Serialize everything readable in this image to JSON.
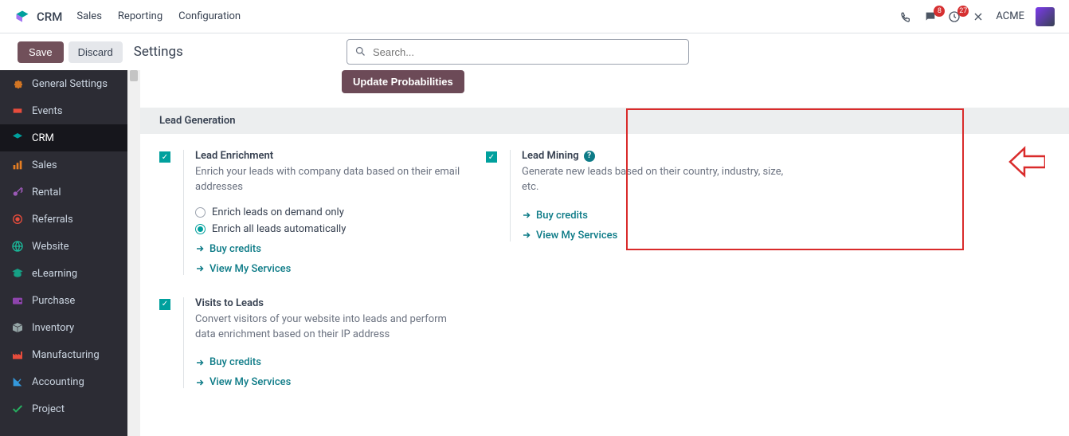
{
  "header": {
    "app_name": "CRM",
    "menu": [
      "Sales",
      "Reporting",
      "Configuration"
    ],
    "company": "ACME",
    "badge_messages": "8",
    "badge_activities": "27"
  },
  "subheader": {
    "save": "Save",
    "discard": "Discard",
    "title": "Settings",
    "search_placeholder": "Search..."
  },
  "sidebar": {
    "items": [
      {
        "label": "General Settings",
        "icon": "gear"
      },
      {
        "label": "Events",
        "icon": "ticket"
      },
      {
        "label": "CRM",
        "icon": "crm"
      },
      {
        "label": "Sales",
        "icon": "bars"
      },
      {
        "label": "Rental",
        "icon": "key"
      },
      {
        "label": "Referrals",
        "icon": "target"
      },
      {
        "label": "Website",
        "icon": "globe"
      },
      {
        "label": "eLearning",
        "icon": "graduation"
      },
      {
        "label": "Purchase",
        "icon": "wallet"
      },
      {
        "label": "Inventory",
        "icon": "box"
      },
      {
        "label": "Manufacturing",
        "icon": "factory"
      },
      {
        "label": "Accounting",
        "icon": "chart"
      },
      {
        "label": "Project",
        "icon": "check"
      }
    ],
    "active_index": 2
  },
  "buttons": {
    "update_probabilities": "Update Probabilities"
  },
  "section": {
    "title": "Lead Generation"
  },
  "settings": {
    "lead_enrichment": {
      "title": "Lead Enrichment",
      "desc": "Enrich your leads with company data based on their email addresses",
      "radio1": "Enrich leads on demand only",
      "radio2": "Enrich all leads automatically",
      "buy_credits": "Buy credits",
      "view_services": "View My Services"
    },
    "lead_mining": {
      "title": "Lead Mining",
      "desc": "Generate new leads based on their country, industry, size, etc.",
      "buy_credits": "Buy credits",
      "view_services": "View My Services"
    },
    "visits_to_leads": {
      "title": "Visits to Leads",
      "desc": "Convert visitors of your website into leads and perform data enrichment based on their IP address",
      "buy_credits": "Buy credits",
      "view_services": "View My Services"
    }
  }
}
